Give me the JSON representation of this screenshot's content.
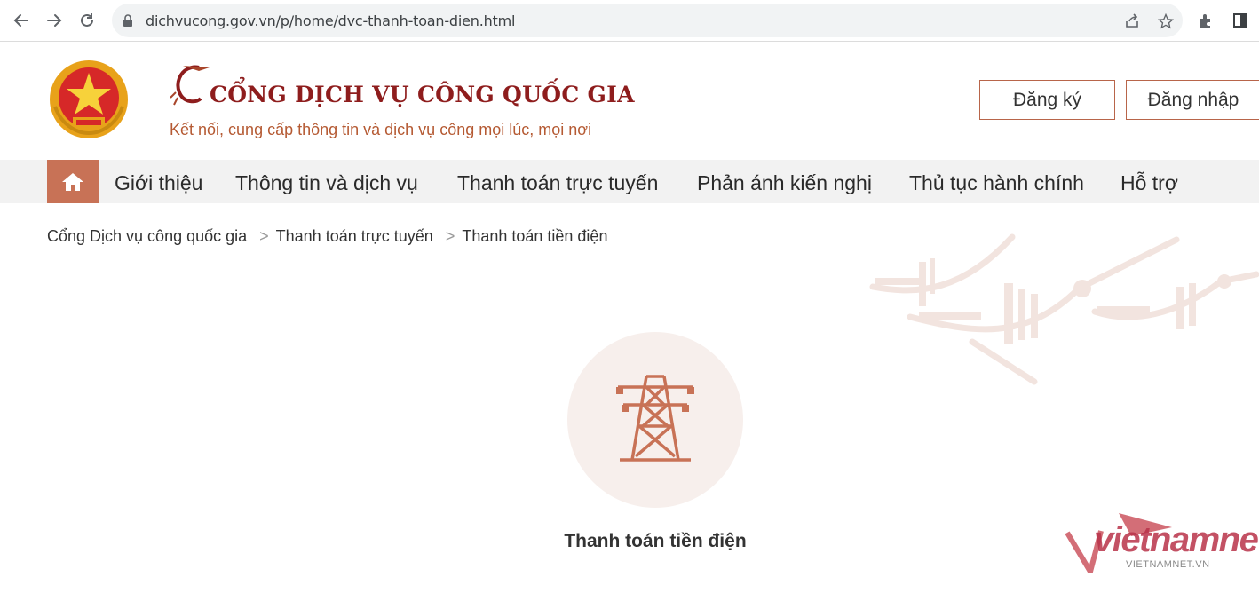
{
  "browser": {
    "url": "dichvucong.gov.vn/p/home/dvc-thanh-toan-dien.html",
    "icons": [
      "back-icon",
      "forward-icon",
      "reload-icon",
      "lock-icon",
      "share-icon",
      "star-icon",
      "extensions-icon",
      "sidepanel-icon"
    ]
  },
  "header": {
    "title": "CỔNG DỊCH VỤ CÔNG QUỐC GIA",
    "slogan": "Kết nối, cung cấp thông tin và dịch vụ công mọi lúc, mọi nơi",
    "register_label": "Đăng ký",
    "login_label": "Đăng nhập"
  },
  "nav": {
    "home_icon": "home-icon",
    "items": [
      {
        "label": "Giới thiệu"
      },
      {
        "label": "Thông tin và dịch vụ"
      },
      {
        "label": "Thanh toán trực tuyến"
      },
      {
        "label": "Phản ánh kiến nghị"
      },
      {
        "label": "Thủ tục hành chính"
      },
      {
        "label": "Hỗ trợ"
      }
    ]
  },
  "breadcrumb": {
    "separator": ">",
    "items": [
      "Cổng Dịch vụ công quốc gia",
      "Thanh toán trực tuyến",
      "Thanh toán tiền điện"
    ]
  },
  "service": {
    "icon": "power-tower-icon",
    "label": "Thanh toán tiền điện"
  },
  "watermark": {
    "text": "vietnamnet",
    "sub": "VIETNAMNET.VN"
  },
  "colors": {
    "accent": "#c87256",
    "title": "#8e1d1d",
    "slogan": "#b55a33",
    "nav_bg": "#f2f2f2",
    "circle_bg": "#f7efec"
  }
}
